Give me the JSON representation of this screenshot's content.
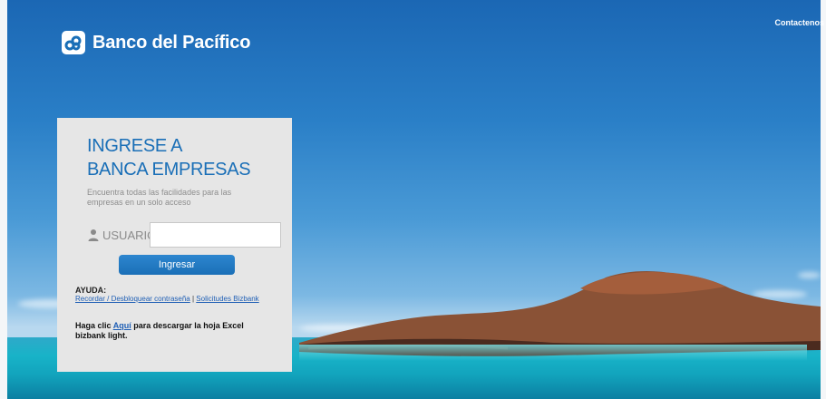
{
  "header": {
    "contact_link": "Contactenos",
    "brand_name": "Banco del Pacífico",
    "brand_icon": "banco-logo-icon",
    "brand_color": "#1a6fb7"
  },
  "login_panel": {
    "title_line1": "INGRESE A",
    "title_line2": "BANCA EMPRESAS",
    "subtitle": "Encuentra todas las facilidades para las empresas en un solo acceso",
    "user_icon": "user-icon",
    "user_label": "USUARIO",
    "user_value": "",
    "submit_label": "Ingresar",
    "help": {
      "title": "AYUDA:",
      "link_recover": "Recordar / Desbloquear contraseña",
      "separator": "|",
      "link_requests": "Solicitudes Bizbank"
    },
    "download": {
      "prefix": "Haga clic",
      "link": "Aquí",
      "suffix": "para descargar la hoja Excel bizbank light."
    }
  },
  "colors": {
    "accent": "#1a6fb7",
    "link": "#1f5fb5",
    "panel_bg": "#e6e6e6"
  }
}
